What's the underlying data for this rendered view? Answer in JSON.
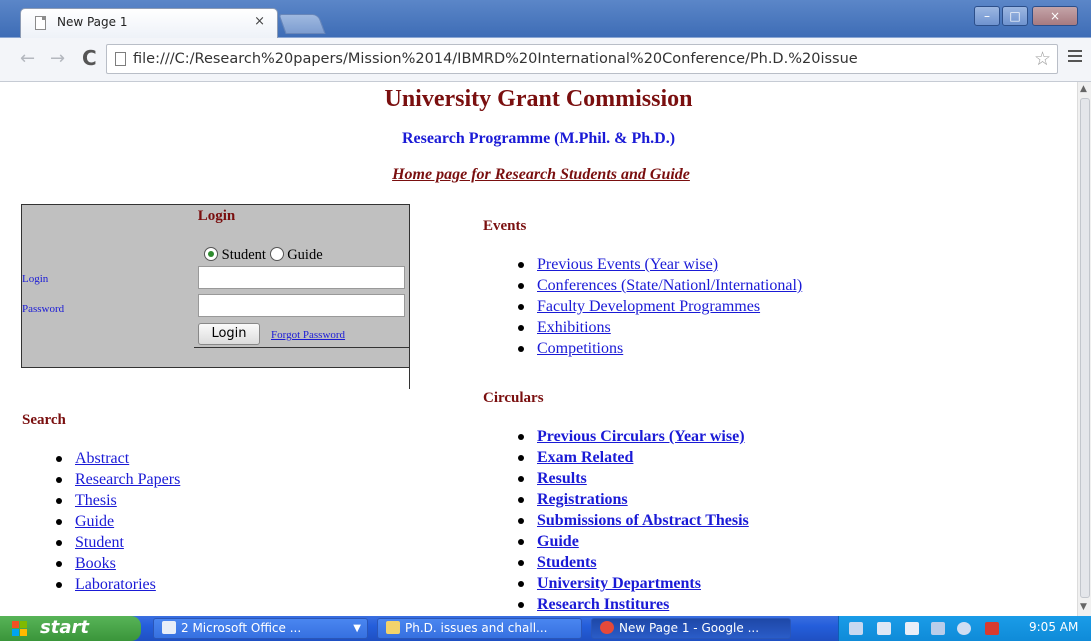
{
  "browser": {
    "tab_title": "New Page 1",
    "tab_close": "×",
    "url": "file:///C:/Research%20papers/Mission%2014/IBMRD%20International%20Conference/Ph.D.%20issue",
    "back": "←",
    "forward": "→",
    "reload": "C",
    "star": "☆"
  },
  "page": {
    "title": "University Grant Commission",
    "subtitle": "Research Programme (M.Phil. & Ph.D.)",
    "home_link": "Home page for Research Students and Guide"
  },
  "login": {
    "heading": "Login",
    "role_student": "Student",
    "role_guide": "Guide",
    "selected_role": "Student",
    "login_label": "Login",
    "password_label": "Password",
    "login_value": "",
    "password_value": "",
    "button_label": "Login",
    "forgot_link": "Forgot Password"
  },
  "search": {
    "heading": "Search",
    "items": [
      "Abstract",
      "Research Papers",
      "Thesis",
      "Guide",
      "Student",
      "Books",
      "Laboratories"
    ]
  },
  "events": {
    "heading": "Events",
    "items": [
      "Previous Events (Year wise)",
      "Conferences (State/Nationl/International)",
      "Faculty Development Programmes",
      "Exhibitions",
      "Competitions"
    ]
  },
  "circulars": {
    "heading": "Circulars",
    "items": [
      "Previous Circulars (Year wise)",
      "Exam Related",
      "Results",
      "Registrations",
      "Submissions of Abstract Thesis",
      "Guide",
      "Students",
      "University Departments",
      "Research Institures"
    ]
  },
  "taskbar": {
    "start_label": "start",
    "items": [
      "2 Microsoft Office ...",
      "Ph.D. issues and chall...",
      "New Page 1 - Google ..."
    ],
    "clock": "9:05 AM"
  },
  "colors": {
    "heading_maroon": "#7a0f0f",
    "link_blue": "#1a1ad6",
    "login_box_gray": "#c0c0c0"
  }
}
